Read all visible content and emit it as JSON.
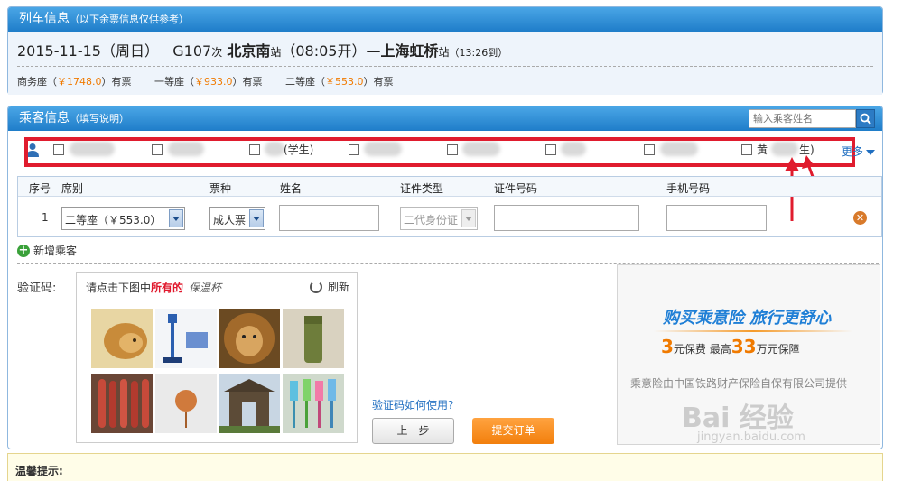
{
  "train": {
    "header": "列车信息",
    "header_note": "（以下余票信息仅供参考）",
    "date": "2015-11-15（周日）",
    "train_no": "G107",
    "train_suffix": "次",
    "from": "北京南",
    "from_suffix": "站",
    "depart": "（08:05开）—",
    "to": "上海虹桥",
    "to_suffix": "站",
    "arrive": "（13:26到）",
    "seats": [
      {
        "name": "商务座（",
        "price": "￥1748.0",
        "status": "）有票"
      },
      {
        "name": "一等座（",
        "price": "￥933.0",
        "status": "）有票"
      },
      {
        "name": "二等座（",
        "price": "￥553.0",
        "status": "）有票"
      }
    ]
  },
  "passenger": {
    "header": "乘客信息",
    "header_note": "（填写说明）",
    "search_placeholder": "输入乘客姓名",
    "list": [
      {
        "label": ""
      },
      {
        "label": ""
      },
      {
        "label": "(学生)"
      },
      {
        "label": ""
      },
      {
        "label": ""
      },
      {
        "label": ""
      },
      {
        "label": ""
      },
      {
        "label": "黄"
      }
    ],
    "last_suffix": "生)",
    "more": "更多",
    "columns": [
      "序号",
      "席别",
      "票种",
      "姓名",
      "证件类型",
      "证件号码",
      "手机号码"
    ],
    "row": {
      "index": "1",
      "seat": "二等座（￥553.0）",
      "ticket_type": "成人票",
      "name": "",
      "id_type": "二代身份证",
      "id_no": "",
      "phone": ""
    },
    "add": "新增乘客"
  },
  "captcha": {
    "label": "验证码:",
    "prompt_prefix": "请点击下图中",
    "prompt_strong": "所有的",
    "prompt_target": "保温杯",
    "refresh": "刷新",
    "howto": "验证码如何使用?"
  },
  "actions": {
    "prev": "上一步",
    "submit": "提交订单"
  },
  "ad": {
    "line1": "购买乘意险  旅行更舒心",
    "num1": "3",
    "txt1": "元保费  最高",
    "num2": "33",
    "txt2": "万元保障",
    "line3": "乘意险由中国铁路财产保险自保有限公司提供"
  },
  "tips": {
    "title": "温馨提示:"
  },
  "watermark": {
    "text": "Bai 经验",
    "url": "jingyan.baidu.com"
  }
}
